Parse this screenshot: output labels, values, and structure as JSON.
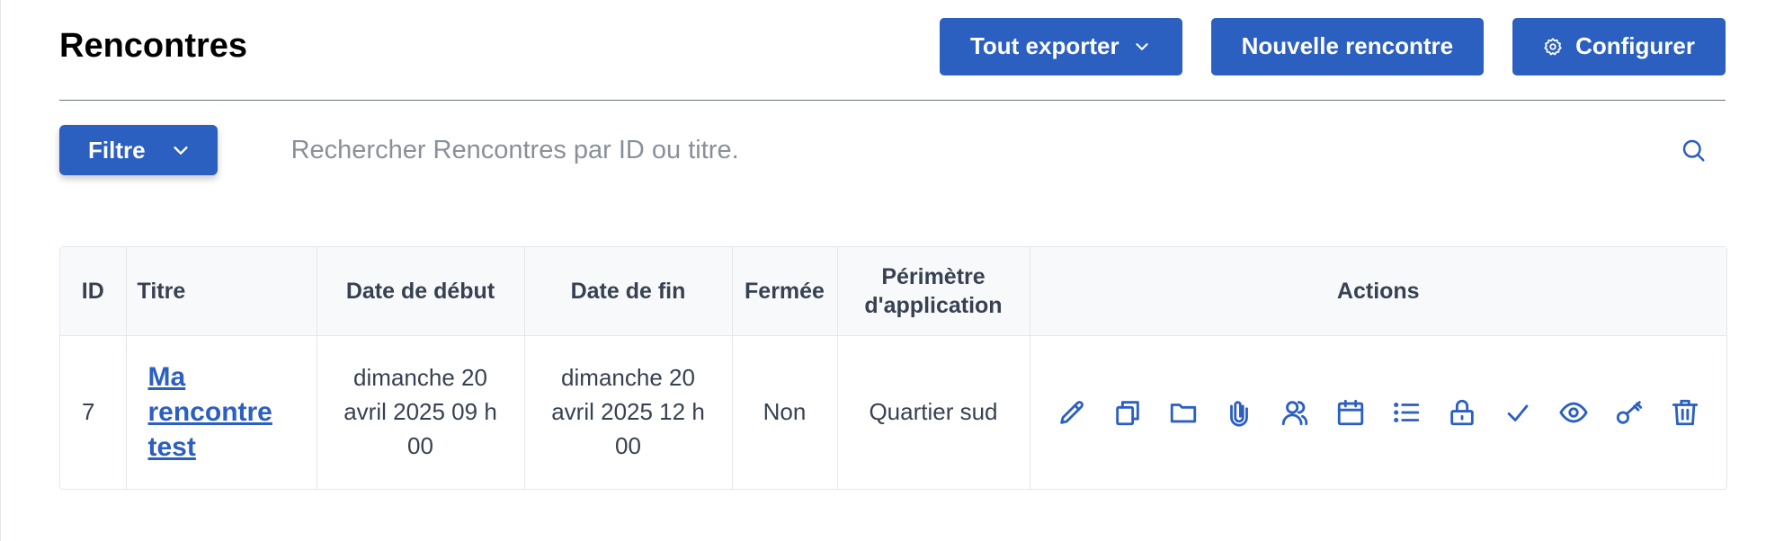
{
  "header": {
    "title": "Rencontres",
    "export_label": "Tout exporter",
    "new_label": "Nouvelle rencontre",
    "configure_label": "Configurer"
  },
  "toolbar": {
    "filter_label": "Filtre",
    "search_placeholder": "Rechercher Rencontres par ID ou titre."
  },
  "table": {
    "columns": {
      "id": "ID",
      "title": "Titre",
      "start": "Date de début",
      "end": "Date de fin",
      "closed": "Fermée",
      "scope_line1": "Périmètre",
      "scope_line2": "d'application",
      "actions": "Actions"
    },
    "rows": [
      {
        "id": "7",
        "title": "Ma rencontre test",
        "start": "dimanche 20 avril 2025 09 h 00",
        "end": "dimanche 20 avril 2025 12 h 00",
        "closed": "Non",
        "scope": "Quartier sud"
      }
    ],
    "action_icons": [
      "pencil-icon",
      "copy-icon",
      "folder-icon",
      "paperclip-icon",
      "users-icon",
      "calendar-icon",
      "list-icon",
      "lock-icon",
      "check-icon",
      "eye-icon",
      "key-icon",
      "trash-icon"
    ]
  },
  "colors": {
    "accent": "#2b5fc0",
    "header_bg": "#f8f9fb",
    "border": "#e5e7eb"
  }
}
